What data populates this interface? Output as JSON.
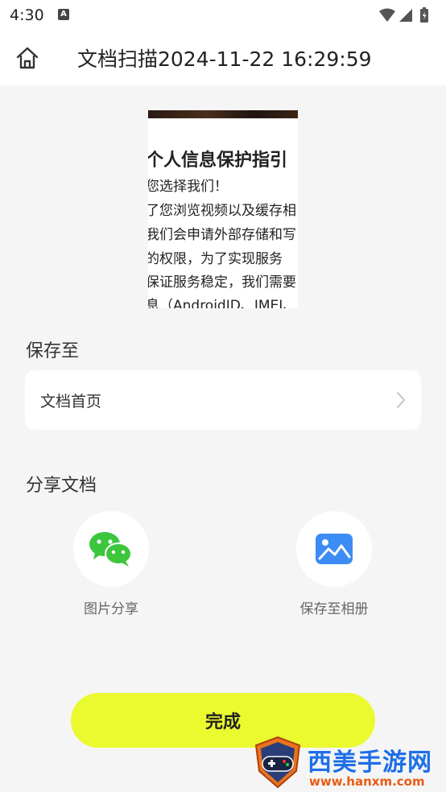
{
  "status_bar": {
    "time": "4:30",
    "notification_icon": "a-icon",
    "right_icons": [
      "wifi-icon",
      "signal-icon",
      "battery-icon"
    ]
  },
  "header": {
    "home_icon": "home-icon",
    "title": "文档扫描2024-11-22 16:29:59"
  },
  "preview": {
    "heading": "个人信息保护指引",
    "lines": [
      "您选择我们！",
      "了您浏览视频以及缓存相",
      "我们会申请外部存储和写",
      "的权限，为了实现服务",
      "保证服务稳定，我们需要",
      "息（AndroidID、IMEI、"
    ]
  },
  "save_section": {
    "label": "保存至",
    "destination": "文档首页",
    "chevron_icon": "chevron-right-icon"
  },
  "share_section": {
    "label": "分享文档",
    "items": [
      {
        "label": "图片分享",
        "icon": "wechat-icon"
      },
      {
        "label": "保存至相册",
        "icon": "gallery-icon"
      }
    ]
  },
  "done_button": {
    "label": "完成"
  },
  "watermark": {
    "text": "西美手游网",
    "url": "www.hanxm.com"
  },
  "colors": {
    "accent": "#eafa2e",
    "background": "#f5f5f5",
    "wechat_green": "#3cc63c",
    "gallery_blue": "#3d8bf5"
  }
}
